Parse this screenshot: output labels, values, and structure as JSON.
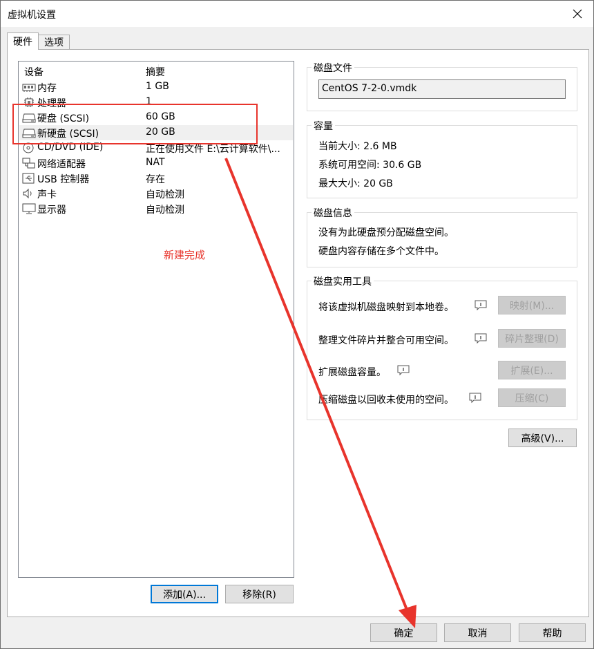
{
  "window": {
    "title": "虚拟机设置"
  },
  "tabs": [
    {
      "label": "硬件"
    },
    {
      "label": "选项"
    }
  ],
  "device_list": {
    "headers": {
      "device": "设备",
      "summary": "摘要"
    },
    "rows": [
      {
        "name": "内存",
        "summary": "1 GB",
        "icon": "memory-icon"
      },
      {
        "name": "处理器",
        "summary": "1",
        "icon": "processor-icon"
      },
      {
        "name": "硬盘 (SCSI)",
        "summary": "60 GB",
        "icon": "hard-disk-icon"
      },
      {
        "name": "新硬盘 (SCSI)",
        "summary": "20 GB",
        "icon": "hard-disk-icon"
      },
      {
        "name": "CD/DVD (IDE)",
        "summary": "正在使用文件 E:\\云计算软件\\...",
        "icon": "cd-dvd-icon"
      },
      {
        "name": "网络适配器",
        "summary": "NAT",
        "icon": "network-adapter-icon"
      },
      {
        "name": "USB 控制器",
        "summary": "存在",
        "icon": "usb-icon"
      },
      {
        "name": "声卡",
        "summary": "自动检测",
        "icon": "sound-card-icon"
      },
      {
        "name": "显示器",
        "summary": "自动检测",
        "icon": "display-icon"
      }
    ],
    "selected_index": 3
  },
  "annotation": {
    "note": "新建完成",
    "color": "#e8342c"
  },
  "list_buttons": {
    "add": "添加(A)...",
    "remove": "移除(R)"
  },
  "disk_file": {
    "label": "磁盘文件",
    "value": "CentOS 7-2-0.vmdk"
  },
  "capacity": {
    "label": "容量",
    "current_size": "当前大小: 2.6 MB",
    "system_available": "系统可用空间: 30.6 GB",
    "max_size": "最大大小: 20 GB"
  },
  "disk_info": {
    "label": "磁盘信息",
    "line1": "没有为此硬盘预分配磁盘空间。",
    "line2": "硬盘内容存储在多个文件中。"
  },
  "disk_utilities": {
    "label": "磁盘实用工具",
    "map_text": "将该虚拟机磁盘映射到本地卷。",
    "map_button": "映射(M)...",
    "defrag_text": "整理文件碎片并整合可用空间。",
    "defrag_button": "碎片整理(D)",
    "expand_text": "扩展磁盘容量。",
    "expand_button": "扩展(E)...",
    "compact_text": "压缩磁盘以回收未使用的空间。",
    "compact_button": "压缩(C)"
  },
  "advanced_button": "高级(V)...",
  "footer": {
    "ok": "确定",
    "cancel": "取消",
    "help": "帮助"
  },
  "colors": {
    "accent": "#0078d7",
    "annotation_red": "#e8342c"
  }
}
